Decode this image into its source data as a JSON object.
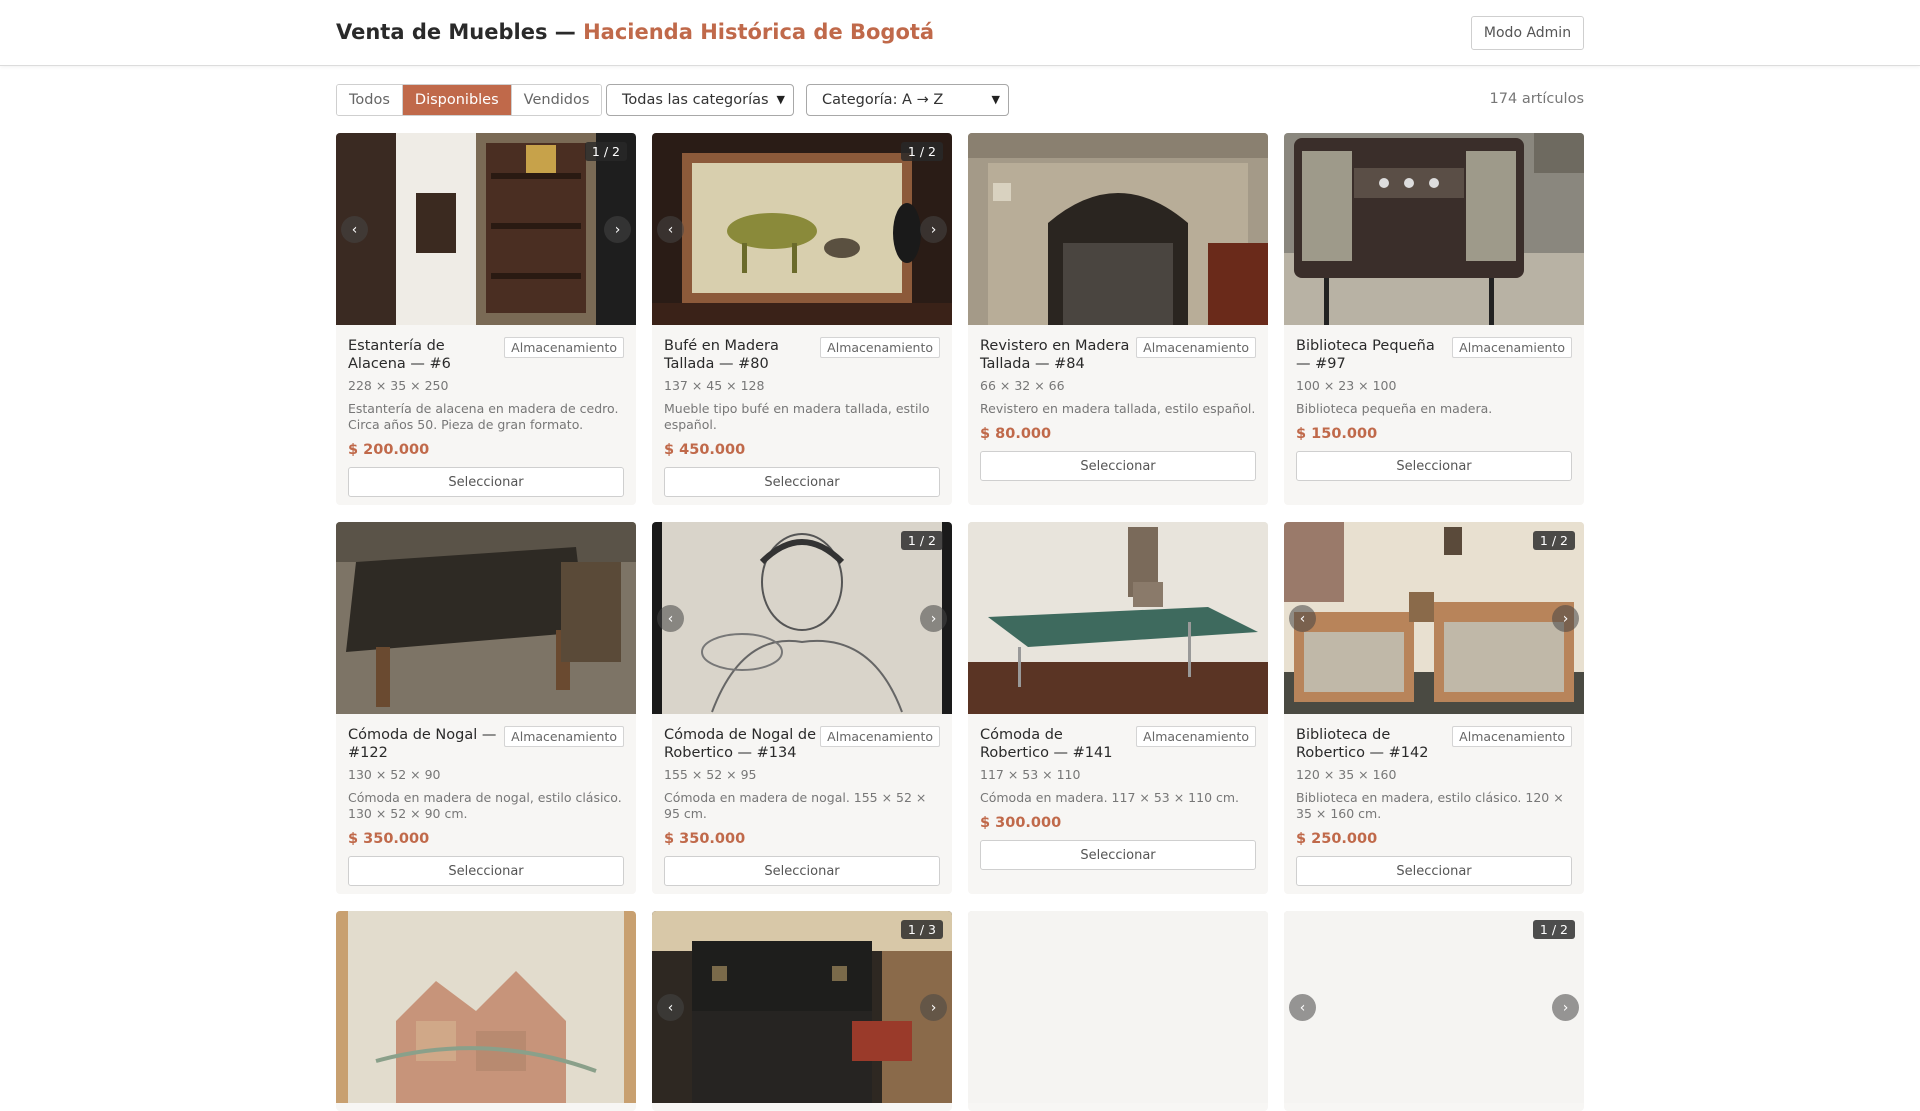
{
  "header": {
    "title_main": "Venta de Muebles — ",
    "title_accent": "Hacienda Histórica de Bogotá",
    "admin_label": "Modo Admin"
  },
  "filters": {
    "status_tabs": [
      {
        "label": "Todos",
        "active": false
      },
      {
        "label": "Disponibles",
        "active": true
      },
      {
        "label": "Vendidos",
        "active": false
      }
    ],
    "category_select": "Todas las categorías",
    "sort_select": "Categoría: A → Z",
    "count": "174 artículos"
  },
  "colors": {
    "accent": "#c0694a",
    "card_bg": "#f7f6f4"
  },
  "items": [
    {
      "name": "Estantería de Alacena — #6",
      "category": "Almacenamiento",
      "dims": "228 × 35 × 250",
      "desc": "Estantería de alacena en madera de cedro. Circa años 50. Pieza de gran formato.",
      "price": "$ 200.000",
      "button": "Seleccionar",
      "counter": "1 / 2",
      "photo": "shelf"
    },
    {
      "name": "Bufé en Madera Tallada — #80",
      "category": "Almacenamiento",
      "dims": "137 × 45 × 128",
      "desc": "Mueble tipo bufé en madera tallada, estilo español.",
      "price": "$ 450.000",
      "button": "Seleccionar",
      "counter": "1 / 2",
      "photo": "horse"
    },
    {
      "name": "Revistero en Madera Tallada — #84",
      "category": "Almacenamiento",
      "dims": "66 × 32 × 66",
      "desc": "Revistero en madera tallada, estilo español.",
      "price": "$ 80.000",
      "button": "Seleccionar",
      "counter": "",
      "photo": "fireplace"
    },
    {
      "name": "Biblioteca Pequeña — #97",
      "category": "Almacenamiento",
      "dims": "100 × 23 × 100",
      "desc": "Biblioteca pequeña en madera.",
      "price": "$ 150.000",
      "button": "Seleccionar",
      "counter": "",
      "photo": "radio"
    },
    {
      "name": "Cómoda de Nogal — #122",
      "category": "Almacenamiento",
      "dims": "130 × 52 × 90",
      "desc": "Cómoda en madera de nogal, estilo clásico. 130 × 52 × 90 cm.",
      "price": "$ 350.000",
      "button": "Seleccionar",
      "counter": "",
      "photo": "bench"
    },
    {
      "name": "Cómoda de Nogal de Robertico — #134",
      "category": "Almacenamiento",
      "dims": "155 × 52 × 95",
      "desc": "Cómoda en madera de nogal. 155 × 52 × 95 cm.",
      "price": "$ 350.000",
      "button": "Seleccionar",
      "counter": "1 / 2",
      "photo": "sketch"
    },
    {
      "name": "Cómoda de Robertico — #141",
      "category": "Almacenamiento",
      "dims": "117 × 53 × 110",
      "desc": "Cómoda en madera. 117 × 53 × 110 cm.",
      "price": "$ 300.000",
      "button": "Seleccionar",
      "counter": "",
      "photo": "pingpong"
    },
    {
      "name": "Biblioteca de Robertico — #142",
      "category": "Almacenamiento",
      "dims": "120 × 35 × 160",
      "desc": "Biblioteca en madera, estilo clásico. 120 × 35 × 160 cm.",
      "price": "$ 250.000",
      "button": "Seleccionar",
      "counter": "1 / 2",
      "photo": "bedroom"
    },
    {
      "name": "",
      "category": "",
      "dims": "",
      "desc": "",
      "price": "",
      "button": "",
      "counter": "",
      "photo": "painting"
    },
    {
      "name": "",
      "category": "",
      "dims": "",
      "desc": "",
      "price": "",
      "button": "",
      "counter": "1 / 3",
      "photo": "trunk"
    },
    {
      "name": "",
      "category": "",
      "dims": "",
      "desc": "",
      "price": "",
      "button": "",
      "counter": "",
      "photo": "blank"
    },
    {
      "name": "",
      "category": "",
      "dims": "",
      "desc": "",
      "price": "",
      "button": "",
      "counter": "1 / 2",
      "photo": "blank"
    }
  ]
}
